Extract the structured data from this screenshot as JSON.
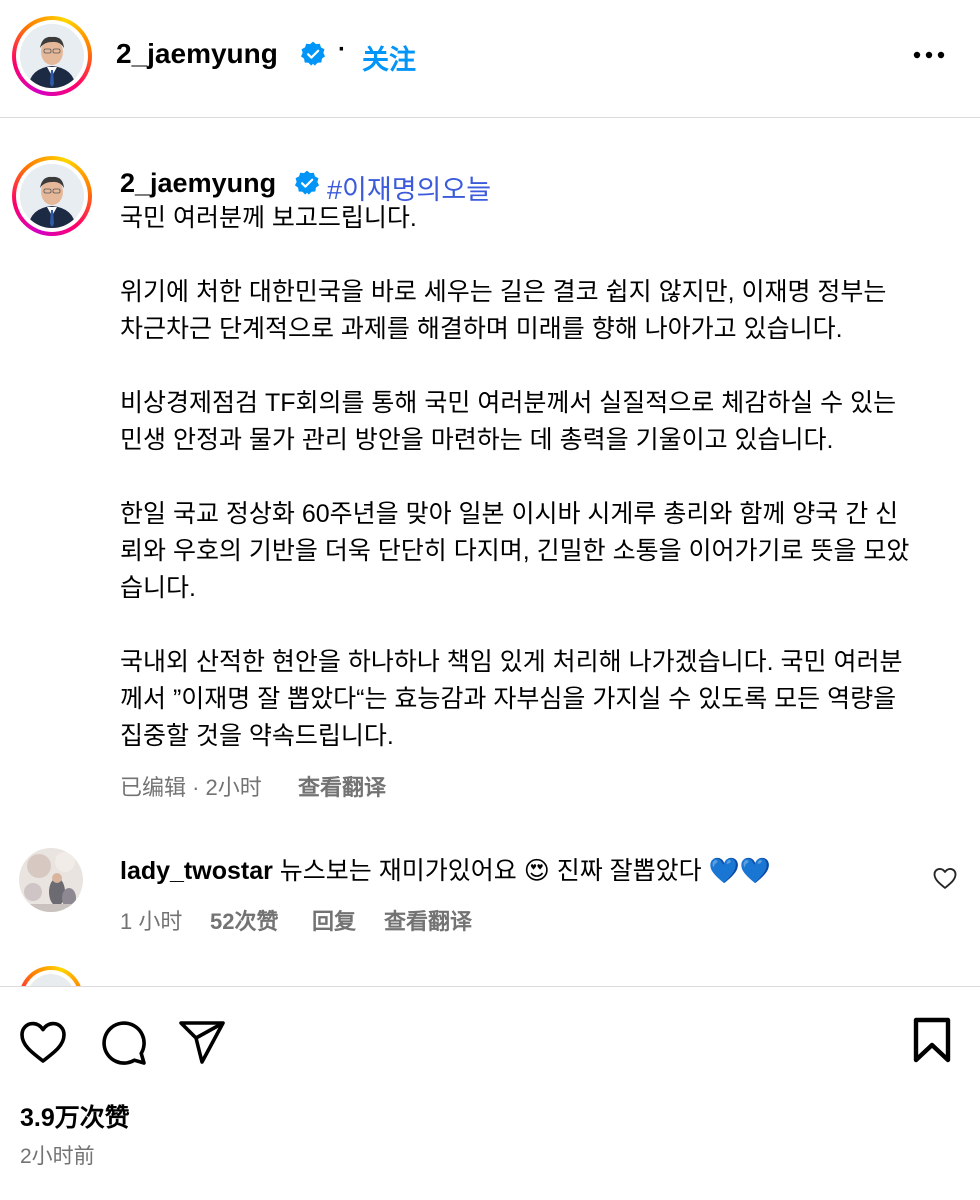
{
  "header": {
    "username": "2_jaemyung",
    "separator": "·",
    "follow_label": "关注"
  },
  "caption": {
    "username": "2_jaemyung",
    "hashtag": "#이재명의오늘",
    "lines": [
      "국민 여러분께 보고드립니다.",
      "위기에 처한 대한민국을 바로 세우는 길은 결코 쉽지 않지만, 이재명 정부는",
      "차근차근 단계적으로 과제를 해결하며 미래를 향해 나아가고 있습니다.",
      "비상경제점검 TF회의를 통해 국민 여러분께서 실질적으로 체감하실 수 있는",
      "민생 안정과 물가 관리 방안을 마련하는 데 총력을 기울이고 있습니다.",
      "한일 국교 정상화 60주년을 맞아 일본 이시바 시게루 총리와 함께 양국 간 신",
      "뢰와 우호의 기반을 더욱 단단히 다지며, 긴밀한 소통을 이어가기로 뜻을 모았",
      "습니다.",
      "국내외 산적한 현안을 하나하나 책임 있게 처리해 나가겠습니다. 국민 여러분",
      "께서 ”이재명 잘 뽑았다“는 효능감과 자부심을 가지실 수 있도록 모든 역량을",
      "집중할 것을 약속드립니다."
    ],
    "edited_time": "已编辑 · 2小时",
    "translate_label": "查看翻译"
  },
  "comment": {
    "username": "lady_twostar",
    "text_before_emoji": "뉴스보는 재미가있어요",
    "emoji": "😍",
    "text_after_emoji": "진짜 잘뽑았다",
    "hearts": "💙💙",
    "time": "1 小时",
    "likes": "52次赞",
    "reply_label": "回复",
    "translate_label": "查看翻译"
  },
  "footer": {
    "likes_count": "3.9万次赞",
    "time_ago": "2小时前"
  },
  "colors": {
    "link_blue": "#0095f6",
    "hashtag_blue": "#3b5bdb",
    "secondary_text": "#737373",
    "divider": "#dbdbdb"
  },
  "icons": [
    "verified-badge-icon",
    "more-options-icon",
    "heart-icon",
    "comment-icon",
    "share-icon",
    "bookmark-icon"
  ]
}
